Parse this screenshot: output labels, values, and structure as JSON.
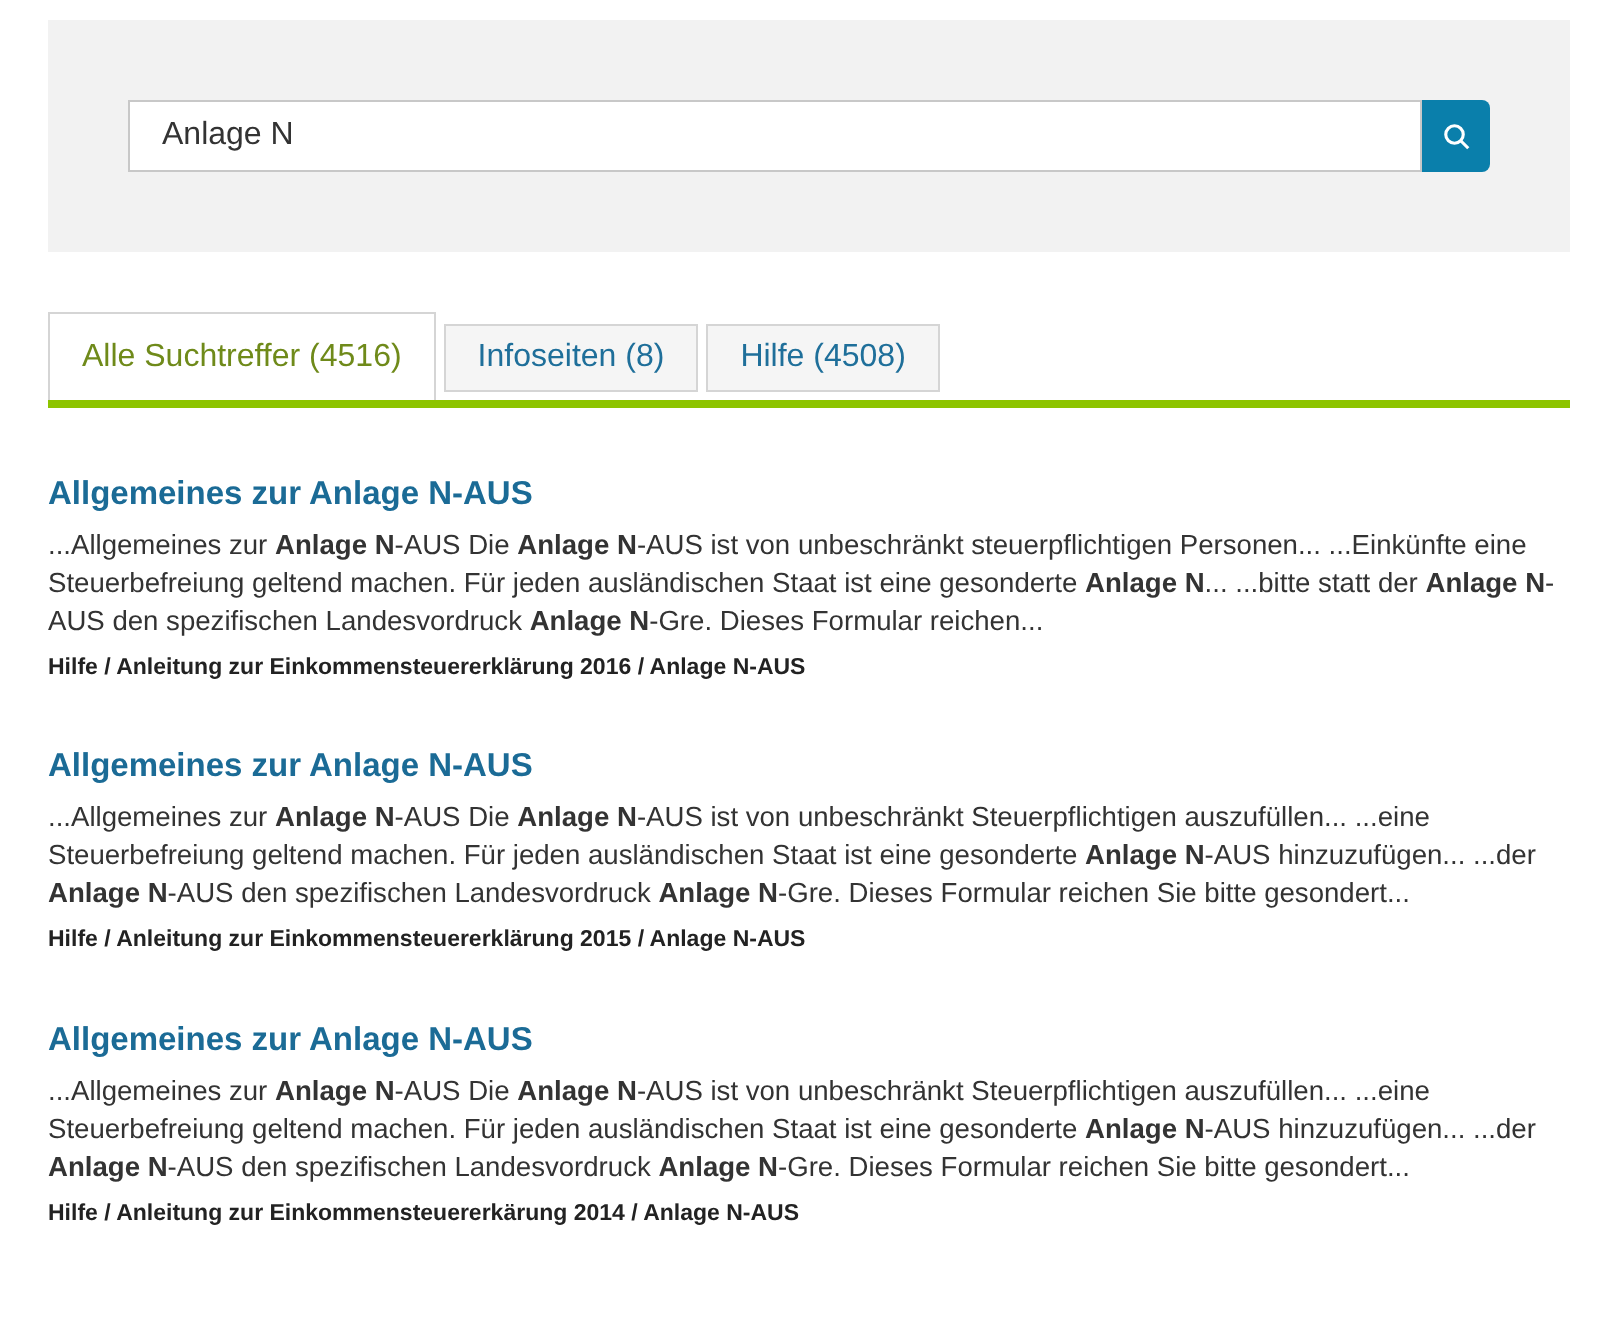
{
  "search": {
    "value": "Anlage N"
  },
  "tabs": [
    {
      "label": "Alle Suchtreffer (4516)",
      "selected": true
    },
    {
      "label": "Infoseiten (8)",
      "selected": false
    },
    {
      "label": "Hilfe (4508)",
      "selected": false
    }
  ],
  "results": [
    {
      "title": "Allgemeines zur Anlage N-AUS",
      "snippet": "...Allgemeines zur **Anlage N**-AUS Die **Anlage N**-AUS ist von unbeschränkt steuerpflichtigen Personen... ...Einkünfte eine Steuerbefreiung geltend machen. Für jeden ausländischen Staat ist eine gesonderte **Anlage N**... ...bitte statt der **Anlage N**-AUS den spezifischen Landesvordruck **Anlage N**-Gre. Dieses Formular reichen...",
      "path": "Hilfe / Anleitung zur Einkommensteuererklärung 2016 / Anlage N-AUS"
    },
    {
      "title": "Allgemeines zur Anlage N-AUS",
      "snippet": "...Allgemeines zur **Anlage N**-AUS Die **Anlage N**-AUS ist von unbeschränkt Steuerpflichtigen auszufüllen... ...eine Steuerbefreiung geltend machen. Für jeden ausländischen Staat ist eine gesonderte **Anlage N**-AUS hinzuzufügen... ...der **Anlage N**-AUS den spezifischen Landesvordruck **Anlage N**-Gre. Dieses Formular reichen Sie bitte gesondert...",
      "path": "Hilfe / Anleitung zur Einkommensteuererklärung 2015 / Anlage N-AUS"
    },
    {
      "title": "Allgemeines zur Anlage N-AUS",
      "snippet": "...Allgemeines zur **Anlage N**-AUS Die **Anlage N**-AUS ist von unbeschränkt Steuerpflichtigen auszufüllen... ...eine Steuerbefreiung geltend machen. Für jeden ausländischen Staat ist eine gesonderte **Anlage N**-AUS hinzuzufügen... ...der **Anlage N**-AUS den spezifischen Landesvordruck **Anlage N**-Gre. Dieses Formular reichen Sie bitte gesondert...",
      "path": "Hilfe / Anleitung zur Einkommensteuererkärung 2014 / Anlage N-AUS"
    }
  ]
}
